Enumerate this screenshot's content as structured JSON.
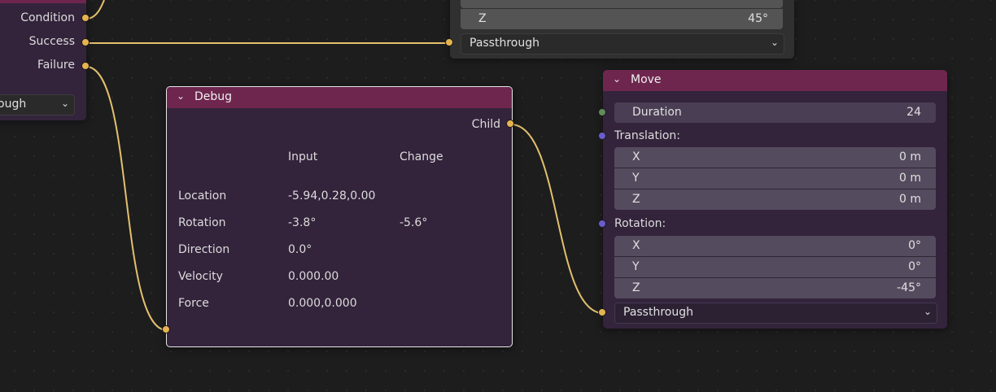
{
  "colors": {
    "wire": "#e3c06f",
    "node_header": "#6e264e",
    "node_body": "#33233b",
    "socket_yellow": "#e6b34f",
    "socket_purple": "#6a5cd0",
    "socket_green": "#5f8e5a"
  },
  "left_node": {
    "outputs": [
      "Condition",
      "Success",
      "Failure"
    ],
    "dropdown_value": "ough"
  },
  "top_node": {
    "rotation_z": {
      "label": "Z",
      "value": "45°"
    },
    "dropdown_value": "Passthrough"
  },
  "debug_node": {
    "title": "Debug",
    "output": "Child",
    "columns": [
      "Input",
      "Change"
    ],
    "rows": [
      {
        "label": "Location",
        "input": "-5.94,0.28,0.00",
        "change": ""
      },
      {
        "label": "Rotation",
        "input": "-3.8°",
        "change": "-5.6°"
      },
      {
        "label": "Direction",
        "input": "0.0°",
        "change": ""
      },
      {
        "label": "Velocity",
        "input": "0.000.00",
        "change": ""
      },
      {
        "label": "Force",
        "input": "0.000,0.000",
        "change": ""
      }
    ]
  },
  "move_node": {
    "title": "Move",
    "duration": {
      "label": "Duration",
      "value": "24"
    },
    "translation_label": "Translation:",
    "translation": [
      {
        "label": "X",
        "value": "0 m"
      },
      {
        "label": "Y",
        "value": "0 m"
      },
      {
        "label": "Z",
        "value": "0 m"
      }
    ],
    "rotation_label": "Rotation:",
    "rotation": [
      {
        "label": "X",
        "value": "0°"
      },
      {
        "label": "Y",
        "value": "0°"
      },
      {
        "label": "Z",
        "value": "-45°"
      }
    ],
    "dropdown_value": "Passthrough"
  }
}
